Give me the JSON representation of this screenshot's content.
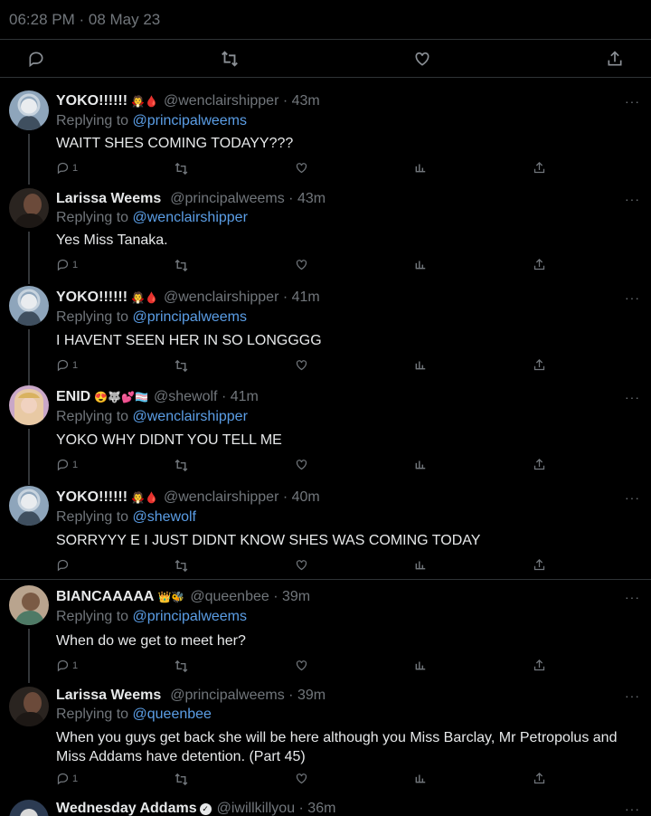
{
  "tweet_meta": "06:28 PM · 08 May 23",
  "colors": {
    "background": "#000000",
    "link": "#5b9ee6",
    "muted": "#71767b",
    "divider": "#2f3336"
  },
  "main_actions": [
    {
      "icon": "reply-icon"
    },
    {
      "icon": "retweet-icon"
    },
    {
      "icon": "like-icon"
    },
    {
      "icon": "share-icon"
    }
  ],
  "replies": [
    {
      "name": "YOKO!!!!!!",
      "emoji": "🧛🩸",
      "handle": "@wenclairshipper · 43m",
      "replying_label": "Replying to",
      "replying_to": "@principalweems",
      "text": "WAITT SHES COMING TODAYY???",
      "reply_count": "1"
    },
    {
      "name": "Larissa Weems",
      "emoji": "",
      "handle": "@principalweems · 43m",
      "replying_label": "Replying to",
      "replying_to": "@wenclairshipper",
      "text": "Yes Miss Tanaka.",
      "reply_count": "1"
    },
    {
      "name": "YOKO!!!!!!",
      "emoji": "🧛🩸",
      "handle": "@wenclairshipper · 41m",
      "replying_label": "Replying to",
      "replying_to": "@principalweems",
      "text": "I HAVENT SEEN HER IN SO LONGGGG",
      "reply_count": "1"
    },
    {
      "name": "ENID",
      "emoji": "😍🐺💕🏳️‍⚧️",
      "handle": "@shewolf · 41m",
      "replying_label": "Replying to",
      "replying_to": "@wenclairshipper",
      "text": "YOKO WHY DIDNT YOU TELL ME",
      "reply_count": "1"
    },
    {
      "name": "YOKO!!!!!!",
      "emoji": "🧛🩸",
      "handle": "@wenclairshipper · 40m",
      "replying_label": "Replying to",
      "replying_to": "@shewolf",
      "text": "SORRYYY E I JUST DIDNT KNOW SHES WAS COMING TODAY",
      "reply_count": ""
    },
    {
      "name": "BIANCAAAAA",
      "emoji": "👑🐝",
      "handle": "@queenbee · 39m",
      "replying_label": "Replying to",
      "replying_to": "@principalweems",
      "text": "When do we get to meet her?",
      "reply_count": "1"
    },
    {
      "name": "Larissa Weems",
      "emoji": "",
      "handle": "@principalweems · 39m",
      "replying_label": "Replying to",
      "replying_to": "@queenbee",
      "text": "When you guys get back she will be here although you Miss Barclay, Mr Petropolus and Miss Addams have detention. (Part 45)",
      "reply_count": "1"
    },
    {
      "name": "Wednesday Addams",
      "emoji": "",
      "handle": "@iwillkillyou · 36m",
      "replying_label": "",
      "replying_to": "",
      "text": "",
      "reply_count": ""
    }
  ],
  "more_label": "···"
}
